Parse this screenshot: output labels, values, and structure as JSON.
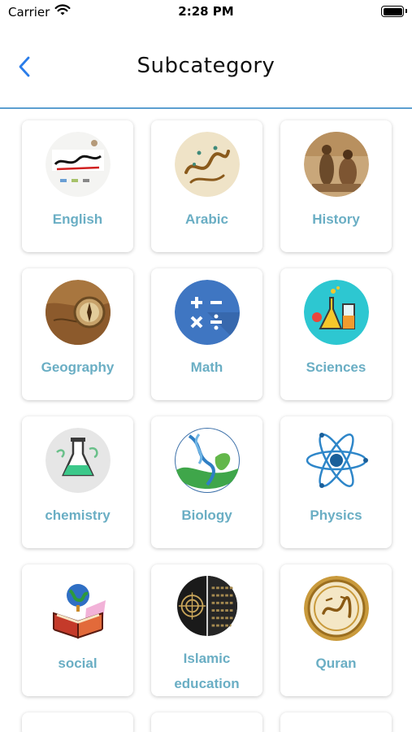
{
  "status_bar": {
    "carrier": "Carrier",
    "time": "2:28 PM"
  },
  "nav": {
    "title": "Subcategory"
  },
  "colors": {
    "accent_blue": "#2b7de9",
    "label_teal": "#6aaec4",
    "divider": "#5c9fd0"
  },
  "subcategories": [
    {
      "label": "English",
      "icon": "english-icon"
    },
    {
      "label": "Arabic",
      "icon": "arabic-calligraphy-icon"
    },
    {
      "label": "History",
      "icon": "history-painting-icon"
    },
    {
      "label": "Geography",
      "icon": "compass-map-icon"
    },
    {
      "label": "Math",
      "icon": "math-operators-icon"
    },
    {
      "label": "Sciences",
      "icon": "lab-flasks-icon"
    },
    {
      "label": "chemistry",
      "icon": "chemistry-flask-icon"
    },
    {
      "label": "Biology",
      "icon": "dna-leaf-icon"
    },
    {
      "label": "Physics",
      "icon": "atom-icon"
    },
    {
      "label": "social",
      "icon": "globe-book-icon"
    },
    {
      "label": "Islamic education",
      "icon": "islamic-pattern-icon"
    },
    {
      "label": "Quran",
      "icon": "quran-icon"
    }
  ]
}
